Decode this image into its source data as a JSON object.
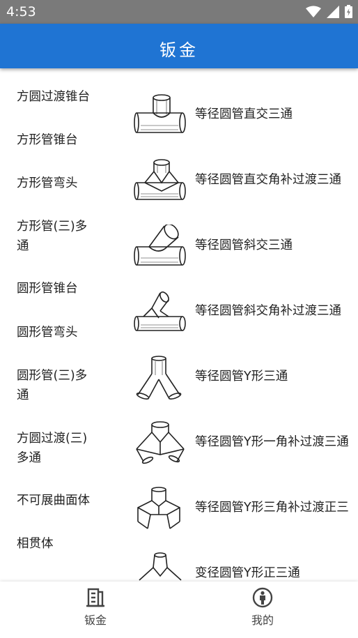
{
  "status": {
    "time": "4:53"
  },
  "appbar": {
    "title": "钣金"
  },
  "left_categories": [
    "方圆过渡锥台",
    "方形管锥台",
    "方形管弯头",
    "方形管(三)多\n通",
    "圆形管锥台",
    "圆形管弯头",
    "圆形管(三)多\n通",
    "方圆过渡(三)\n多通",
    "不可展曲面体",
    "相贯体"
  ],
  "right_items": [
    {
      "label": "等径圆管直交三通",
      "icon": "tee-pipe-icon"
    },
    {
      "label": "等径圆管直交角补过渡三通",
      "icon": "tee-transition-pipe-icon"
    },
    {
      "label": "等径圆管斜交三通",
      "icon": "oblique-tee-pipe-icon"
    },
    {
      "label": "等径圆管斜交角补过渡三通",
      "icon": "oblique-transition-pipe-icon"
    },
    {
      "label": "等径圆管Y形三通",
      "icon": "y-pipe-icon"
    },
    {
      "label": "等径圆管Y形一角补过渡三通",
      "icon": "y-one-transition-pipe-icon"
    },
    {
      "label": "等径圆管Y形三角补过渡正三",
      "icon": "y-three-transition-pipe-icon"
    },
    {
      "label": "变径圆管Y形正三通",
      "icon": "reducing-y-pipe-icon"
    }
  ],
  "bottom_nav": [
    {
      "label": "钣金",
      "icon": "document-list-icon",
      "active": true
    },
    {
      "label": "我的",
      "icon": "person-icon",
      "active": false
    }
  ]
}
